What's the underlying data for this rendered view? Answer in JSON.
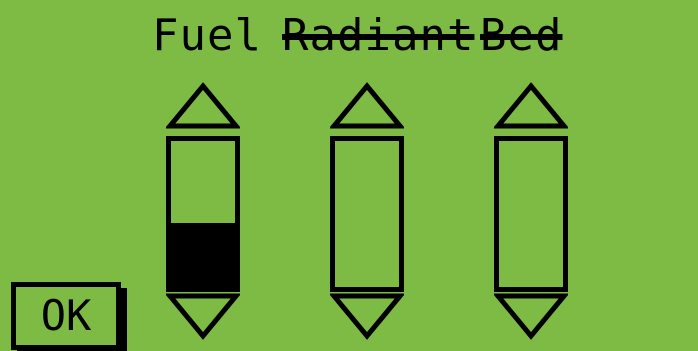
{
  "channels": [
    {
      "label": "Fuel",
      "enabled": true,
      "level": 0.44
    },
    {
      "label": "Radiant",
      "enabled": false,
      "level": 0
    },
    {
      "label": "Bed",
      "enabled": false,
      "level": 0
    }
  ],
  "controls": {
    "up_icon": "up-arrow-icon",
    "down_icon": "down-arrow-icon",
    "ok_label": "OK"
  },
  "colors": {
    "background": "#7dbb44",
    "foreground": "#000000"
  }
}
